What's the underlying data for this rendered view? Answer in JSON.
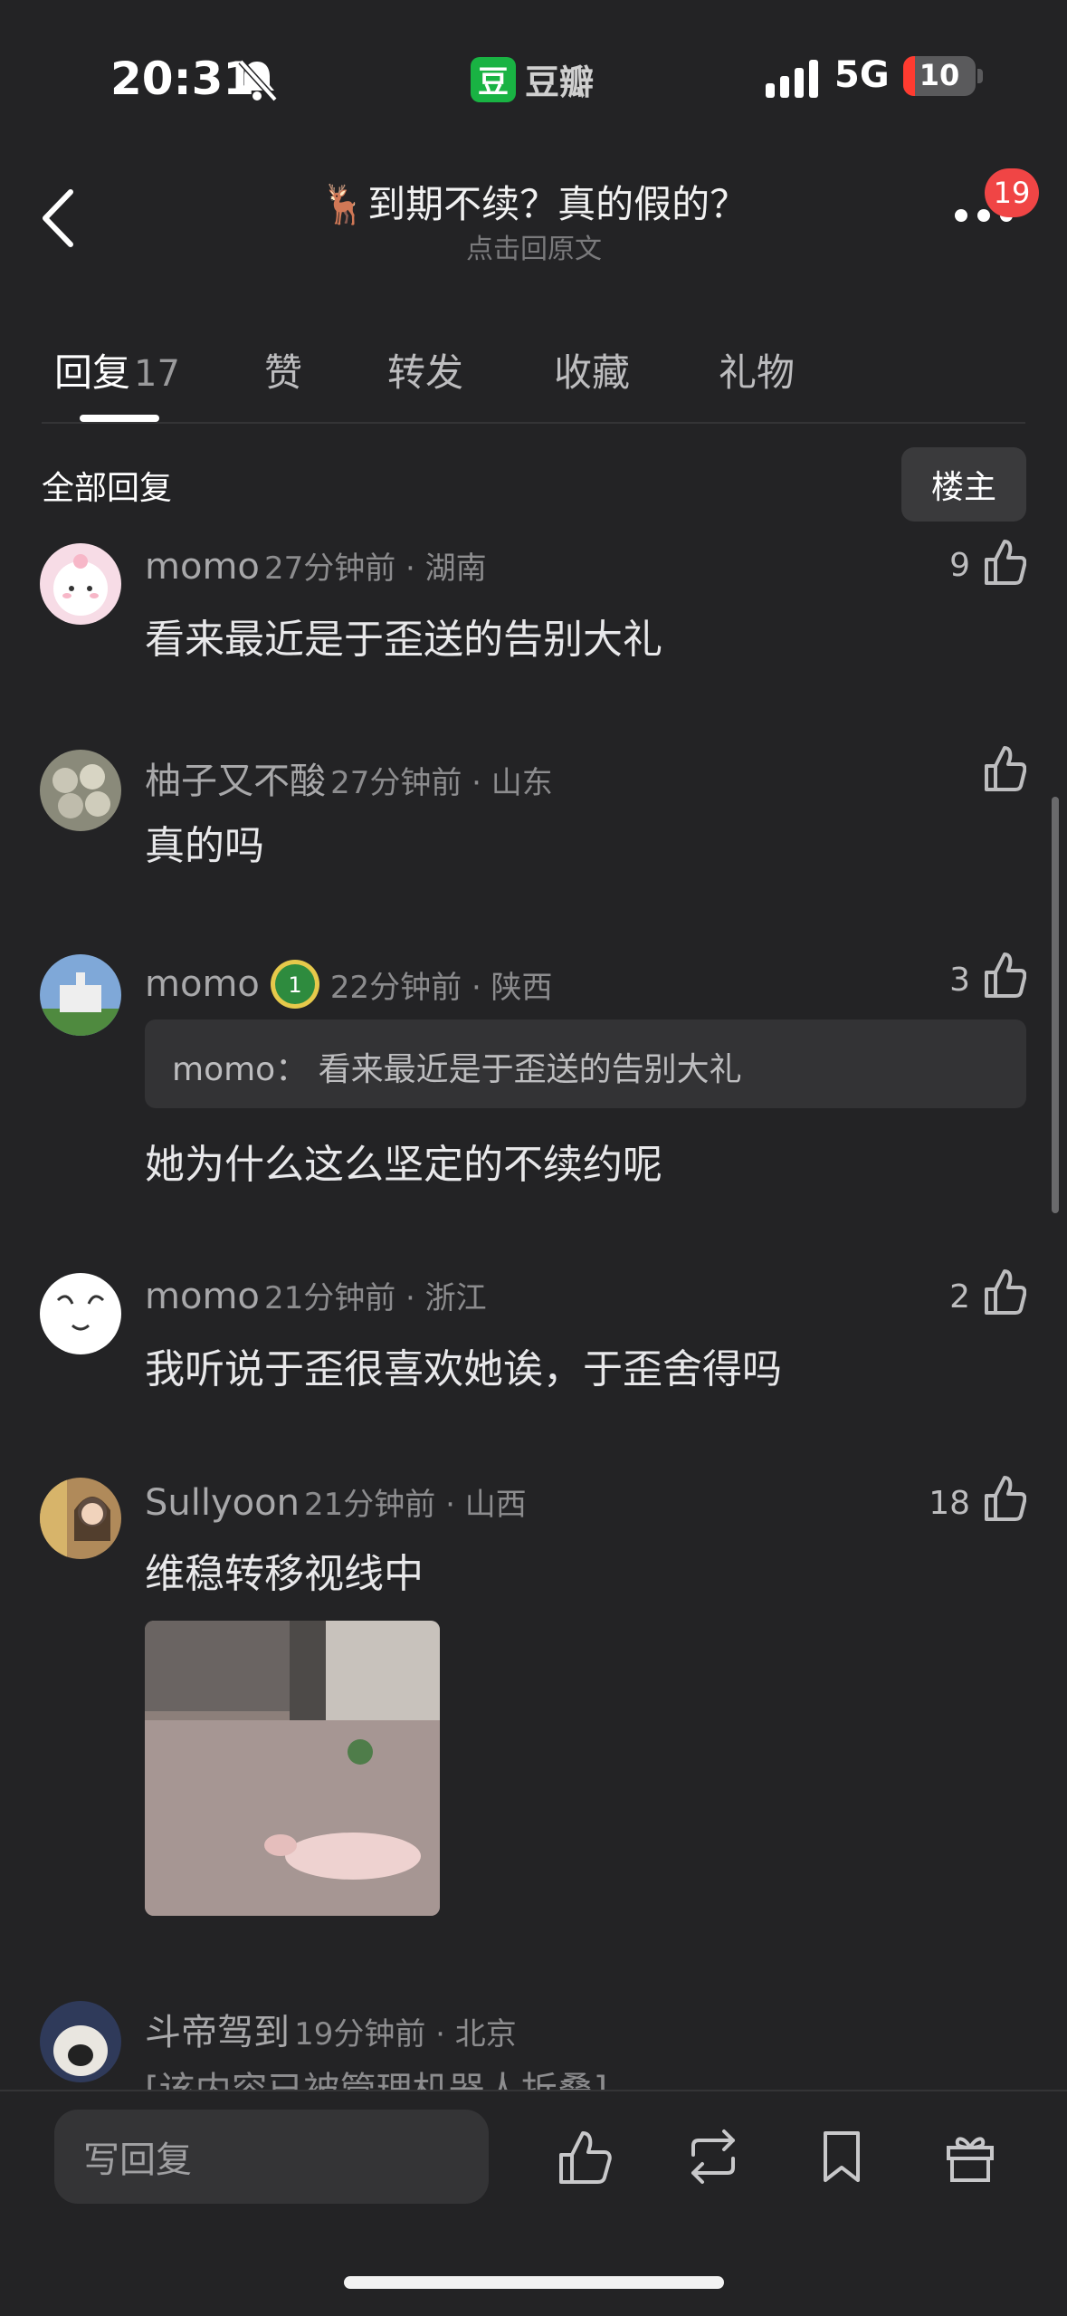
{
  "status_bar": {
    "time": "20:31",
    "app_name": "豆瓣",
    "app_logo": "豆",
    "network": "5G",
    "battery": "10"
  },
  "nav": {
    "title": "🦌到期不续？真的假的？",
    "subtitle": "点击回原文",
    "badge": "19"
  },
  "tabs": [
    {
      "label": "回复",
      "count": "17"
    },
    {
      "label": "赞"
    },
    {
      "label": "转发"
    },
    {
      "label": "收藏"
    },
    {
      "label": "礼物"
    }
  ],
  "section": {
    "all_replies": "全部回复",
    "op_filter": "楼主"
  },
  "comments": [
    {
      "name": "momo",
      "meta": "27分钟前 · 湖南",
      "text": "看来最近是于歪送的告别大礼",
      "likes": "9"
    },
    {
      "name": "柚子又不酸",
      "meta": "27分钟前 · 山东",
      "text": "真的吗",
      "likes": ""
    },
    {
      "name": "momo",
      "meta": "22分钟前 · 陕西",
      "quote": "momo：  看来最近是于歪送的告别大礼",
      "text": "她为什么这么坚定的不续约呢",
      "likes": "3"
    },
    {
      "name": "momo",
      "meta": "21分钟前 · 浙江",
      "text": "我听说于歪很喜欢她诶，于歪舍得吗",
      "likes": "2"
    },
    {
      "name": "Sullyoon",
      "meta": "21分钟前 · 山西",
      "text": "维稳转移视线中",
      "likes": "18"
    },
    {
      "name": "斗帝驾到",
      "meta": "19分钟前 · 北京",
      "text": "[该内容已被管理机器人折叠]",
      "likes": ""
    }
  ],
  "bottom_bar": {
    "reply_placeholder": "写回复"
  },
  "colors": {
    "background": "#232325",
    "badge": "#f04545",
    "douban_green": "#19b343",
    "battery_low": "#ff3b30"
  },
  "icons": [
    "bell-slash-icon",
    "signal-icon",
    "back-icon",
    "more-icon",
    "like-icon",
    "repost-icon",
    "bookmark-icon",
    "gift-icon"
  ]
}
